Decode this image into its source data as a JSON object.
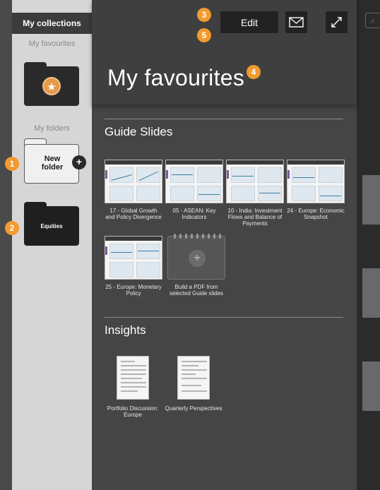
{
  "sidebar": {
    "tab_label": "My collections",
    "favourites_heading": "My favourites",
    "folders_heading": "My folders",
    "new_folder_label": "New folder",
    "equities_label": "Equities"
  },
  "header": {
    "edit_label": "Edit",
    "title": "My favourites"
  },
  "badges": {
    "b1": "1",
    "b2": "2",
    "b3": "3",
    "b4": "4",
    "b5": "5",
    "color": "#f29a2e"
  },
  "guide_slides": {
    "heading": "Guide Slides",
    "items": [
      {
        "caption": "17 - Global Growth and Policy Divergence"
      },
      {
        "caption": "05 - ASEAN: Key Indicators"
      },
      {
        "caption": "10 - India: Investment Flows and Balance of Payments"
      },
      {
        "caption": "24 - Europe: Economic Snapshot"
      },
      {
        "caption": "25 - Europe: Monetary Policy"
      }
    ],
    "build_pdf_label": "Build a PDF from selected Guide slides"
  },
  "insights": {
    "heading": "Insights",
    "items": [
      {
        "caption": "Portfolio Discussion: Europe"
      },
      {
        "caption": "Quarterly Perspectives"
      }
    ]
  },
  "icons": {
    "star": "star-icon",
    "mail": "mail-icon",
    "expand": "expand-icon",
    "plus": "plus-icon",
    "search": "search-icon"
  }
}
